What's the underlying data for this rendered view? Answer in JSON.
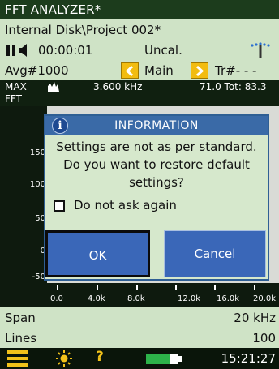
{
  "app": {
    "title": "FFT ANALYZER*"
  },
  "file": {
    "path": "Internal Disk\\Project 002*"
  },
  "status": {
    "elapsed_time": "00:00:01",
    "calibration": "Uncal."
  },
  "toolbar": {
    "avg_label": "Avg#1000",
    "view_label": "Main",
    "trigger_label": "Tr#- - -"
  },
  "readout": {
    "mode": "MAX",
    "measurement": "FFT",
    "frequency": "3.600 kHz",
    "level": "71.0 Tot: 83.3"
  },
  "chart": {
    "y_ticks": [
      "150",
      "100",
      "50",
      "0",
      "-50"
    ],
    "x_ticks": [
      "0.0",
      "4.0k",
      "8.0k",
      "12.0k",
      "16.0k",
      "20.0k"
    ]
  },
  "dialog": {
    "title": "INFORMATION",
    "message_lines": [
      "Settings are not as per standard.",
      "Do you want to restore default",
      "settings?"
    ],
    "checkbox_label": "Do not ask again",
    "checkbox_checked": false,
    "ok_label": "OK",
    "cancel_label": "Cancel"
  },
  "settings": [
    {
      "label": "Span",
      "value": "20 kHz"
    },
    {
      "label": "Lines",
      "value": "100"
    }
  ],
  "taskbar": {
    "time": "15:21:27",
    "help_glyph": "?"
  },
  "colors": {
    "title_bg": "#1c3c1c",
    "panel_bg": "#cfe3c6",
    "accent_yellow": "#f2bc10",
    "dialog_header": "#3a6aa7",
    "button_blue": "#3a67b8"
  }
}
